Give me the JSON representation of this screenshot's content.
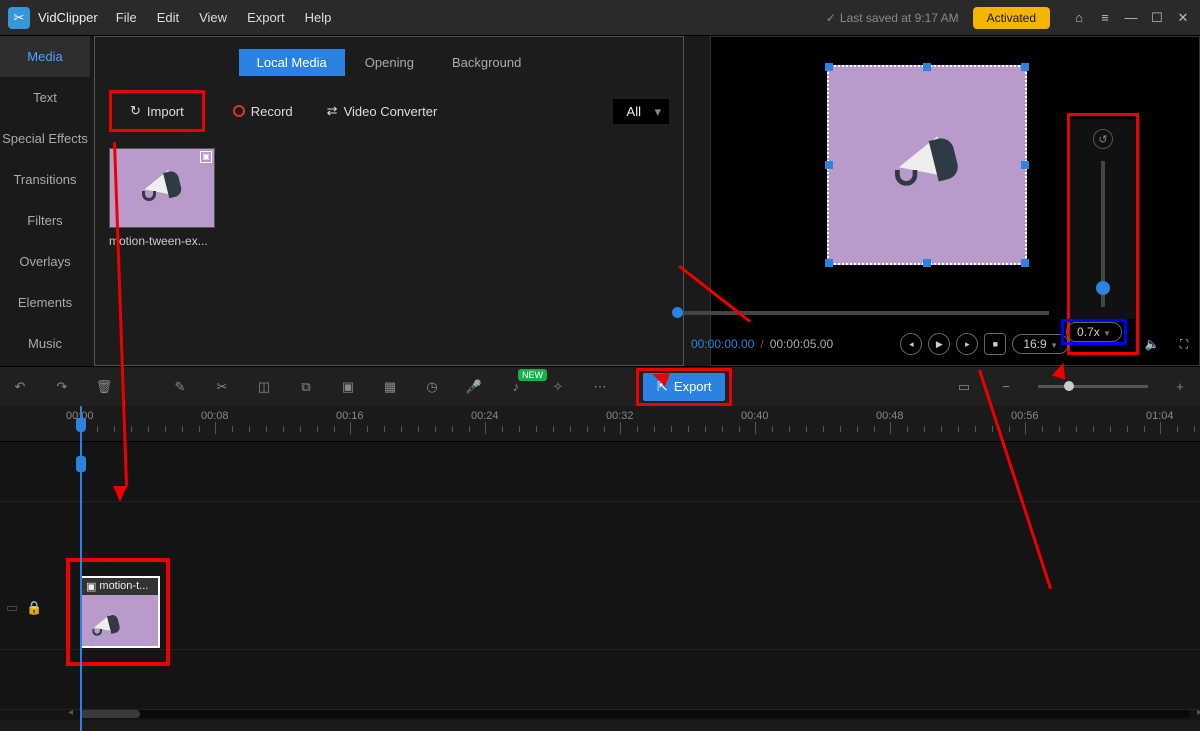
{
  "app": {
    "name": "VidClipper"
  },
  "menu": {
    "file": "File",
    "edit": "Edit",
    "view": "View",
    "export": "Export",
    "help": "Help"
  },
  "titlebar": {
    "autosave": "Last saved at 9:17 AM",
    "activated": "Activated"
  },
  "sidebar": {
    "items": [
      {
        "label": "Media"
      },
      {
        "label": "Text"
      },
      {
        "label": "Special Effects"
      },
      {
        "label": "Transitions"
      },
      {
        "label": "Filters"
      },
      {
        "label": "Overlays"
      },
      {
        "label": "Elements"
      },
      {
        "label": "Music"
      }
    ]
  },
  "media_tabs": {
    "local": "Local Media",
    "opening": "Opening",
    "background": "Background"
  },
  "media_actions": {
    "import": "Import",
    "record": "Record",
    "converter": "Video Converter",
    "filter_all": "All"
  },
  "media_items": [
    {
      "caption": "motion-tween-ex..."
    }
  ],
  "preview": {
    "time_current": "00:00:00.00",
    "time_total": "00:00:05.00",
    "aspect": "16:9",
    "zoom": "0.7x"
  },
  "timeline_toolbar": {
    "export": "Export",
    "new_badge": "NEW"
  },
  "ruler": {
    "labels": [
      "00:00",
      "00:08",
      "00:16",
      "00:24",
      "00:32",
      "00:40",
      "00:48",
      "00:56",
      "01:04"
    ]
  },
  "clip": {
    "label": "motion-t..."
  },
  "colors": {
    "accent": "#2b82e0",
    "highlight": "#e00000",
    "activated": "#f5b400"
  }
}
